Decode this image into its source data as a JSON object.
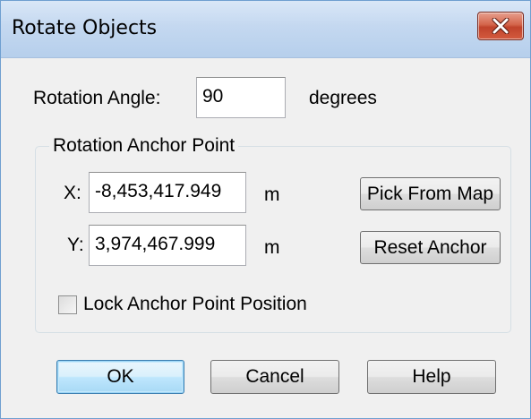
{
  "window": {
    "title": "Rotate Objects",
    "close_icon": "close-icon"
  },
  "rotation": {
    "angle_label": "Rotation Angle:",
    "angle_value": "90",
    "angle_unit": "degrees"
  },
  "anchor": {
    "group_title": "Rotation Anchor Point",
    "x_label": "X:",
    "x_value": "-8,453,417.949",
    "x_unit": "m",
    "y_label": "Y:",
    "y_value": "3,974,467.999",
    "y_unit": "m",
    "pick_button": "Pick From Map",
    "reset_button": "Reset Anchor",
    "lock_label": "Lock Anchor Point Position",
    "lock_checked": false
  },
  "buttons": {
    "ok": "OK",
    "cancel": "Cancel",
    "help": "Help"
  },
  "colors": {
    "close_button": "#c8472c",
    "default_button_border": "#3c7fb1"
  }
}
